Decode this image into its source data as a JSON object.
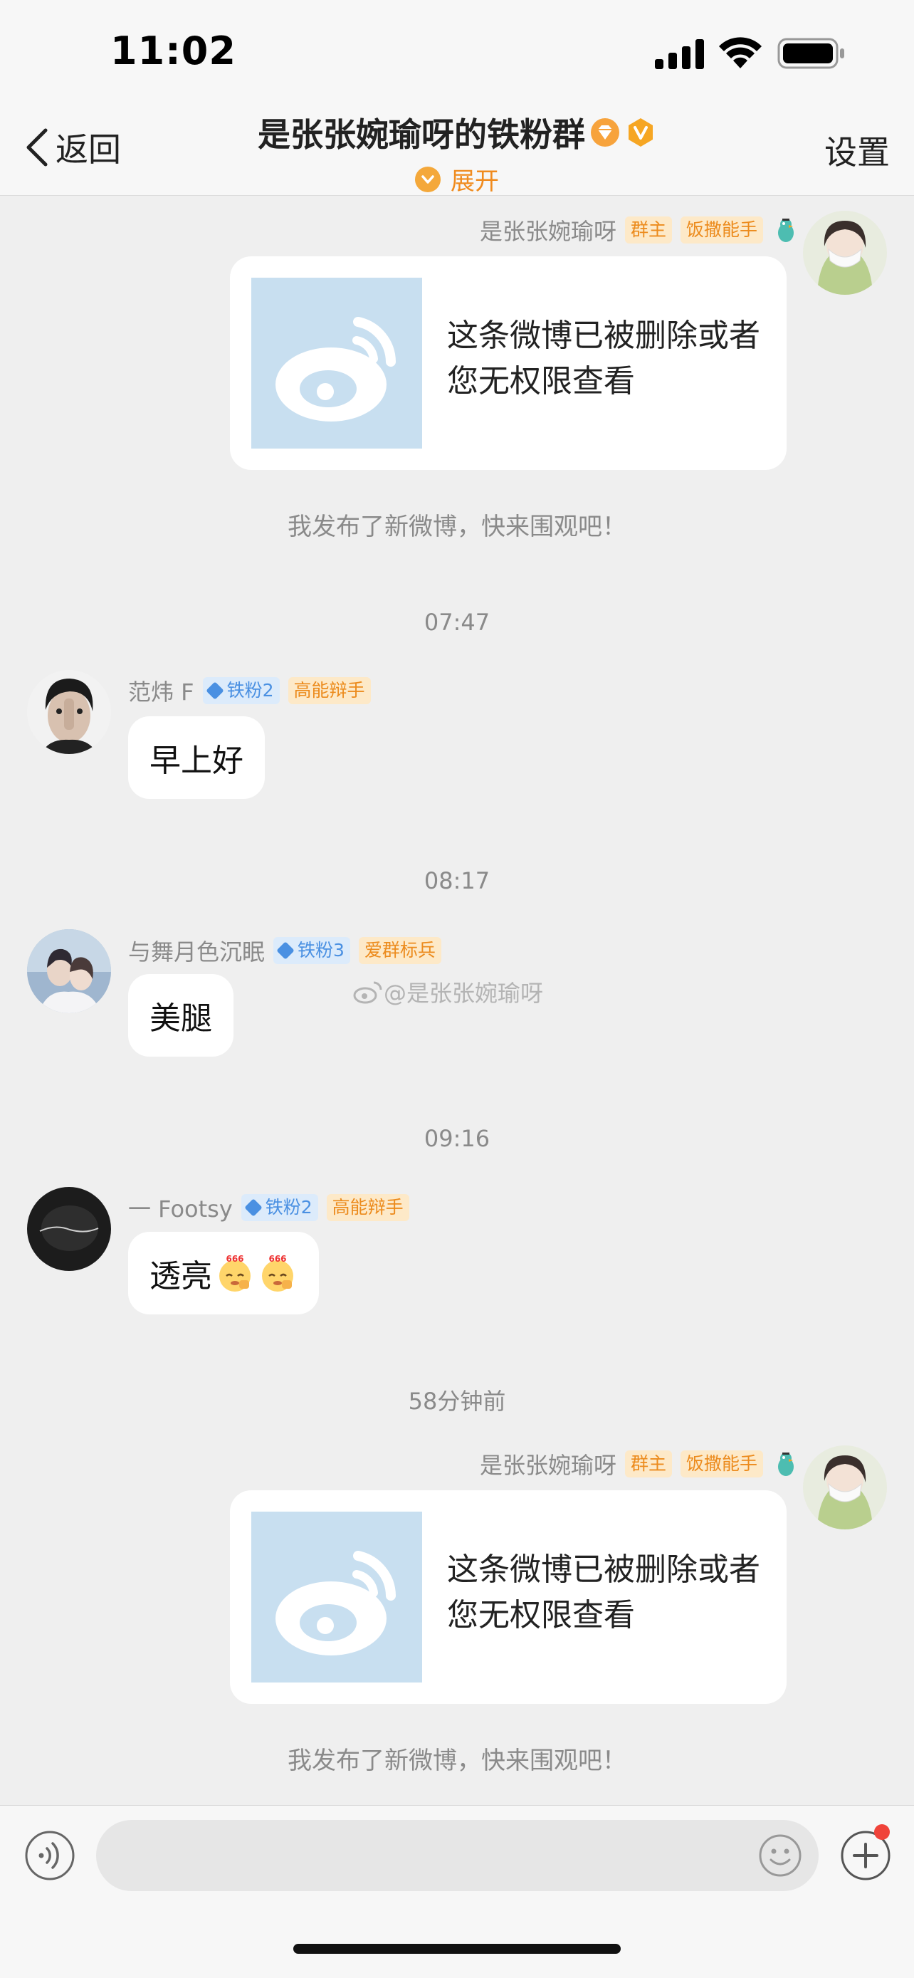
{
  "status_bar": {
    "time": "11:02"
  },
  "nav": {
    "back_label": "返回",
    "title": "是张张婉瑜呀的铁粉群",
    "expand_label": "展开",
    "settings_label": "设置"
  },
  "messages": [
    {
      "sender": "是张张婉瑜呀",
      "badges": [
        "群主",
        "饭撒能手"
      ],
      "card_text": "这条微博已被删除或者您无权限查看",
      "note": "我发布了新微博，快来围观吧！"
    },
    {
      "timestamp": "07:47",
      "sender": "范炜 F",
      "fan_badge": "铁粉2",
      "badge": "高能辩手",
      "text": "早上好"
    },
    {
      "timestamp": "08:17",
      "sender": "与舞月色沉眠",
      "fan_badge": "铁粉3",
      "badge": "爱群标兵",
      "text": "美腿"
    },
    {
      "timestamp": "09:16",
      "sender": "一 Footsy",
      "fan_badge": "铁粉2",
      "badge": "高能辩手",
      "text": "透亮"
    },
    {
      "timestamp": "58分钟前",
      "sender": "是张张婉瑜呀",
      "badges": [
        "群主",
        "饭撒能手"
      ],
      "card_text": "这条微博已被删除或者您无权限查看",
      "note": "我发布了新微博，快来围观吧！"
    }
  ],
  "watermark": "@是张张婉瑜呀",
  "input": {
    "placeholder": ""
  },
  "colors": {
    "accent_orange": "#f08b1e",
    "fan_blue": "#4a90e2",
    "background": "#efefef"
  },
  "icons": [
    "signal-icon",
    "wifi-icon",
    "battery-icon",
    "back-chevron-icon",
    "voice-icon",
    "emoji-icon",
    "plus-icon",
    "weibo-logo-icon",
    "bird-icon"
  ]
}
